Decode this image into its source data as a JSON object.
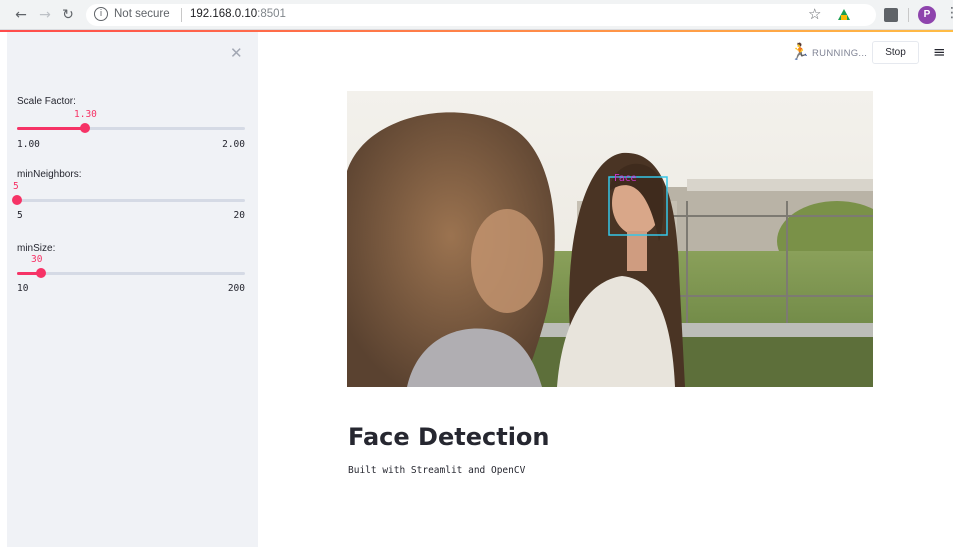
{
  "browser": {
    "security": "Not secure",
    "url_host": "192.168.0.10",
    "url_port": ":8501",
    "profile_initial": "P"
  },
  "header": {
    "status": "RUNNING...",
    "stop_label": "Stop"
  },
  "sidebar": {
    "sliders": [
      {
        "label": "Scale Factor:",
        "value": "1.30",
        "min": "1.00",
        "max": "2.00",
        "fraction": 0.3
      },
      {
        "label": "minNeighbors:",
        "value": "5",
        "min": "5",
        "max": "20",
        "fraction": 0.0
      },
      {
        "label": "minSize:",
        "value": "30",
        "min": "10",
        "max": "200",
        "fraction": 0.105
      }
    ]
  },
  "main": {
    "image_alt": "Face detection result on video frame",
    "detection_label": "Face",
    "title": "Face Detection",
    "subtitle": "Built with Streamlit and OpenCV"
  },
  "colors": {
    "accent": "#f63366",
    "detection_box": "#35c6e8",
    "detection_label": "#c832c8"
  }
}
